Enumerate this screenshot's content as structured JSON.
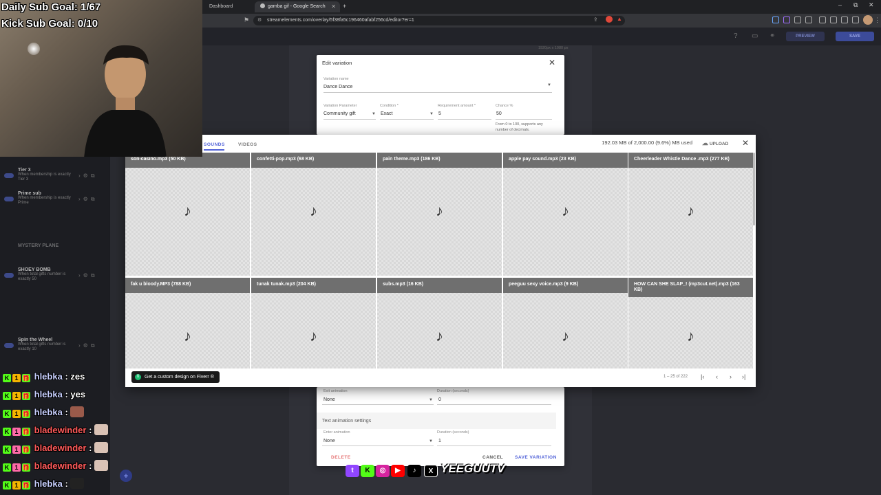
{
  "browser": {
    "tabs": [
      {
        "title": "Dashboard"
      },
      {
        "title": "gamba gif - Google Search"
      }
    ],
    "new_tab": "+",
    "url": "streamelements.com/overlay/5f38fa5c196460afabf256cd/editor?er=1",
    "window_controls": [
      "–",
      "⧉",
      "✕"
    ]
  },
  "editor": {
    "preview_label": "PREVIEW",
    "save_label": "SAVE",
    "canvas_size": "1920px x 1080 px",
    "sidebar_items": [
      {
        "title": "Tier 3",
        "desc": "When membership is exactly Tier 3",
        "on": true
      },
      {
        "title": "Prime sub",
        "desc": "When membership is exactly Prime",
        "on": true
      },
      {
        "title": "MYSTERY PLANE",
        "desc": "",
        "on": false
      },
      {
        "title": "SHOEY BOMB",
        "desc": "When total gifts number is exactly 50",
        "on": true
      },
      {
        "title": "Spin the Wheel",
        "desc": "When total gifts number is exactly 10",
        "on": true
      }
    ]
  },
  "edit_variation": {
    "title": "Edit variation",
    "name_label": "Variation name",
    "name_value": "Dance Dance",
    "param_label": "Variation Parameter",
    "param_value": "Community gift",
    "condition_label": "Condition *",
    "condition_value": "Exact",
    "requirement_label": "Requirement amount *",
    "requirement_value": "5",
    "chance_label": "Chance %",
    "chance_value": "50",
    "chance_hint": "From 0 to 100, supports any number of decimals.",
    "exit_anim_label": "Exit animation",
    "exit_anim_value": "None",
    "exit_duration_label": "Duration (seconds)",
    "exit_duration_value": "0",
    "text_anim_heading": "Text animation settings",
    "enter_anim_label": "Enter animation",
    "enter_anim_value": "None",
    "enter_duration_label": "Duration (seconds)",
    "enter_duration_value": "1",
    "delete_label": "DELETE",
    "cancel_label": "CANCEL",
    "save_label": "SAVE VARIATION"
  },
  "library": {
    "tabs": [
      "SOUNDS",
      "VIDEOS"
    ],
    "active_tab": "SOUNDS",
    "storage": "192.03 MB of 2,000.00 (9.6%) MB used",
    "upload_label": "UPLOAD",
    "files": [
      "son-casino.mp3 (50 KB)",
      "confetti-pop.mp3 (68 KB)",
      "pain theme.mp3 (186 KB)",
      "apple pay sound.mp3 (23 KB)",
      "Cheerleader Whistle Dance .mp3 (277 KB)",
      "fak u bloody.MP3 (788 KB)",
      "tunak tunak.mp3 (204 KB)",
      "subs.mp3 (16 KB)",
      "peeguu sexy voice.mp3 (9 KB)",
      "HOW CAN SHE SLAP_! (mp3cut.net).mp3 (163 KB)"
    ],
    "fiverr_label": "Get a custom design on Fiverr ®",
    "fiverr_badge": "fi",
    "pagination": "1 – 25 of 222",
    "music_glyph": "♪"
  },
  "overlay": {
    "daily_goal": "Daily Sub Goal: 1/67",
    "kick_goal": "Kick Sub Goal: 0/10",
    "chat": [
      {
        "user": "hlebka",
        "message": ": zes",
        "style": "normal"
      },
      {
        "user": "hlebka",
        "message": ": yes",
        "style": "normal"
      },
      {
        "user": "hlebka",
        "message": ":",
        "style": "normal",
        "emote": true
      },
      {
        "user": "bladewinder",
        "message": ":",
        "style": "red",
        "emote": true
      },
      {
        "user": "bladewinder",
        "message": ":",
        "style": "red",
        "emote": true
      },
      {
        "user": "bladewinder",
        "message": ":",
        "style": "red",
        "emote": true
      },
      {
        "user": "hlebka",
        "message": ":",
        "style": "normal",
        "emote": true
      }
    ],
    "badges": {
      "k": "K",
      "one": "1",
      "gift": "🎁"
    },
    "socials": {
      "twitch": "t",
      "kick": "K",
      "instagram": "◎",
      "youtube": "▶",
      "tiktok": "♪",
      "x": "X"
    },
    "handle": "YEEGUUTV"
  },
  "colors": {
    "accent": "#5162d8",
    "kick_green": "#53fc18",
    "delete_red": "#e57373",
    "twitch": "#9146ff",
    "youtube": "#ff0000"
  }
}
